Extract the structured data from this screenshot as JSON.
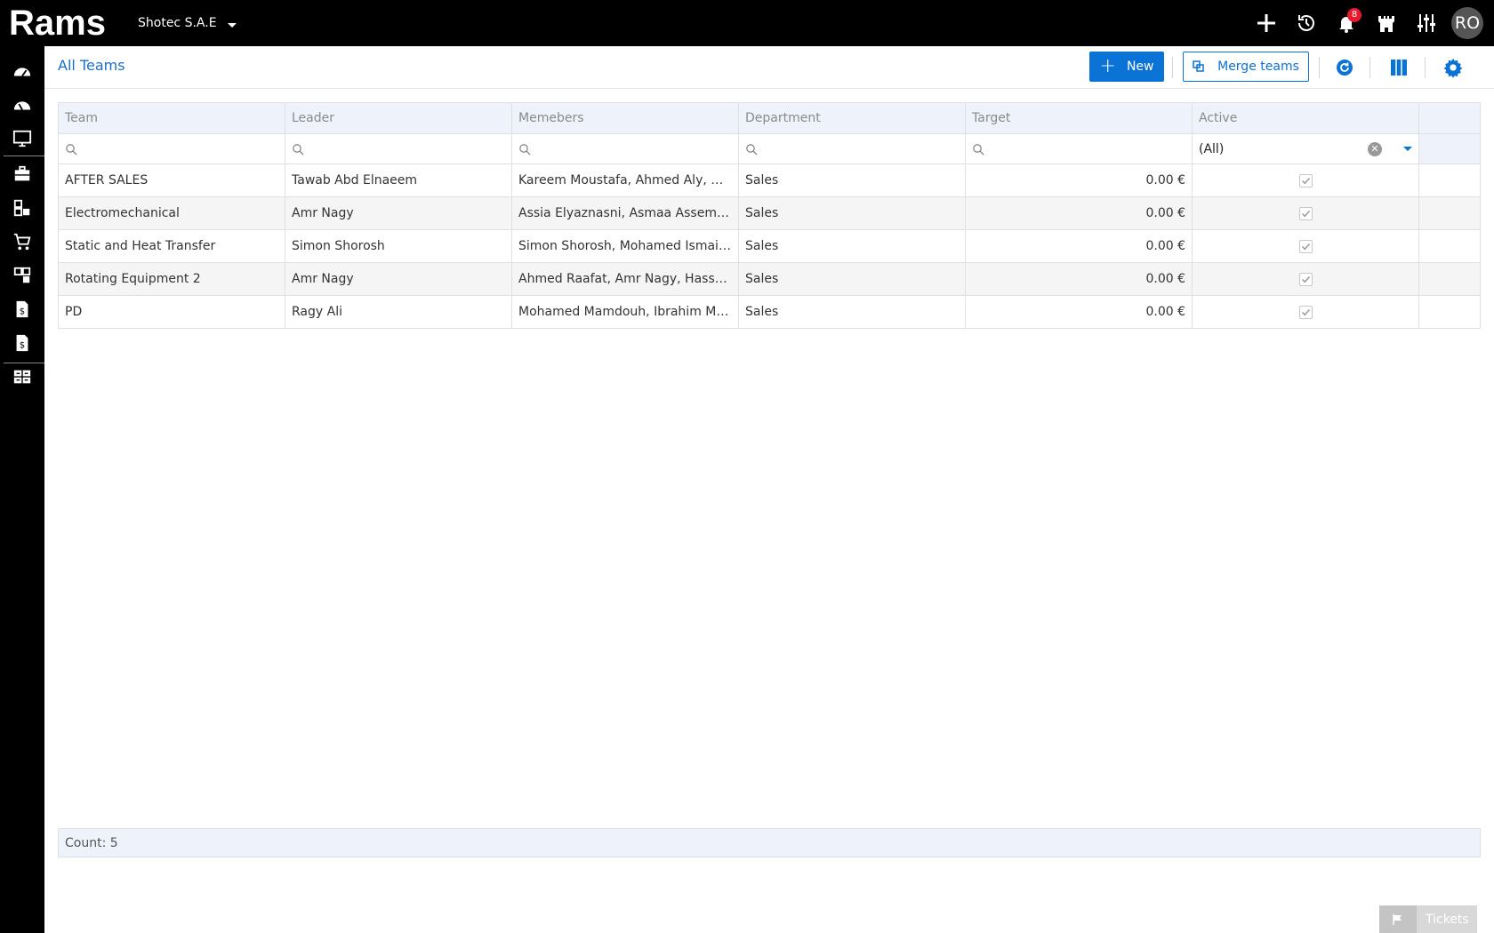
{
  "app": {
    "logo_text": "Rams",
    "company": "Shotec S.A.E",
    "notifications_count": "8",
    "user_initials": "RO"
  },
  "header": {
    "title": "All Teams",
    "new_label": "New",
    "merge_label": "Merge teams"
  },
  "grid": {
    "columns": [
      "Team",
      "Leader",
      "Memebers",
      "Department",
      "Target",
      "Active"
    ],
    "active_filter": "(All)",
    "rows": [
      {
        "team": "AFTER SALES",
        "leader": "Tawab Abd Elnaeem",
        "members": "Kareem Moustafa, Ahmed Aly, Ma...",
        "department": "Sales",
        "target": "0.00 €",
        "active": true
      },
      {
        "team": "Electromechanical",
        "leader": "Amr Nagy",
        "members": "Assia Elyaznasni, Asmaa Assem, ...",
        "department": "Sales",
        "target": "0.00 €",
        "active": true
      },
      {
        "team": "Static and Heat Transfer",
        "leader": "Simon Shorosh",
        "members": "Simon Shorosh, Mohamed Ismail, ...",
        "department": "Sales",
        "target": "0.00 €",
        "active": true
      },
      {
        "team": "Rotating Equipment 2",
        "leader": "Amr Nagy",
        "members": "Ahmed Raafat, Amr Nagy, Hassan ...",
        "department": "Sales",
        "target": "0.00 €",
        "active": true
      },
      {
        "team": "PD",
        "leader": "Ragy Ali",
        "members": "Mohamed Mamdouh, Ibrahim Mu...",
        "department": "Sales",
        "target": "0.00 €",
        "active": true
      }
    ],
    "count_label": "Count: 5"
  },
  "tickets_label": "Tickets",
  "colors": {
    "accent": "#0b72d6",
    "topbar": "#000000",
    "header_row": "#eef3fb",
    "badge": "#e8192c"
  }
}
